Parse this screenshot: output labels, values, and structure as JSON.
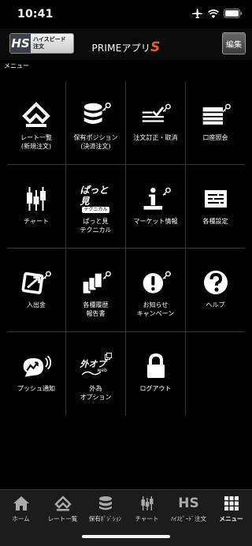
{
  "status": {
    "time": "10:41"
  },
  "header": {
    "hs_logo": "HS",
    "hs_line1": "ハイスピード",
    "hs_line2": "注文",
    "title_main": "PRIMEアプリ",
    "title_s": "S",
    "edit_label": "編集"
  },
  "menu_caption": "メニュー",
  "menu": [
    {
      "label": "レート一覧\n(新規注文)"
    },
    {
      "label": "保有ポジション\n(決済注文)"
    },
    {
      "label": "注文訂正・取消"
    },
    {
      "label": "口座照会"
    },
    {
      "label": "チャート"
    },
    {
      "label": "ぱっと見\nテクニカル",
      "icon_text": "ぱっと見",
      "icon_sub": "テクニカル"
    },
    {
      "label": "マーケット情報"
    },
    {
      "label": "各種設定"
    },
    {
      "label": "入出金"
    },
    {
      "label": "各種履歴\n報告書"
    },
    {
      "label": "お知らせ\nキャンペーン"
    },
    {
      "label": "ヘルプ"
    },
    {
      "label": "プッシュ通知"
    },
    {
      "label": "外為\nオプション",
      "icon_text": "外オプ",
      "icon_sub": "web"
    },
    {
      "label": "ログアウト"
    }
  ],
  "tabs": [
    {
      "label": "ホーム"
    },
    {
      "label": "レート一覧"
    },
    {
      "label": "保有ﾎﾟｼﾞｼｮﾝ"
    },
    {
      "label": "チャート"
    },
    {
      "label": "ﾊｲｽﾋﾟｰﾄﾞ注文",
      "icon_text": "HS"
    },
    {
      "label": "メニュー"
    }
  ]
}
